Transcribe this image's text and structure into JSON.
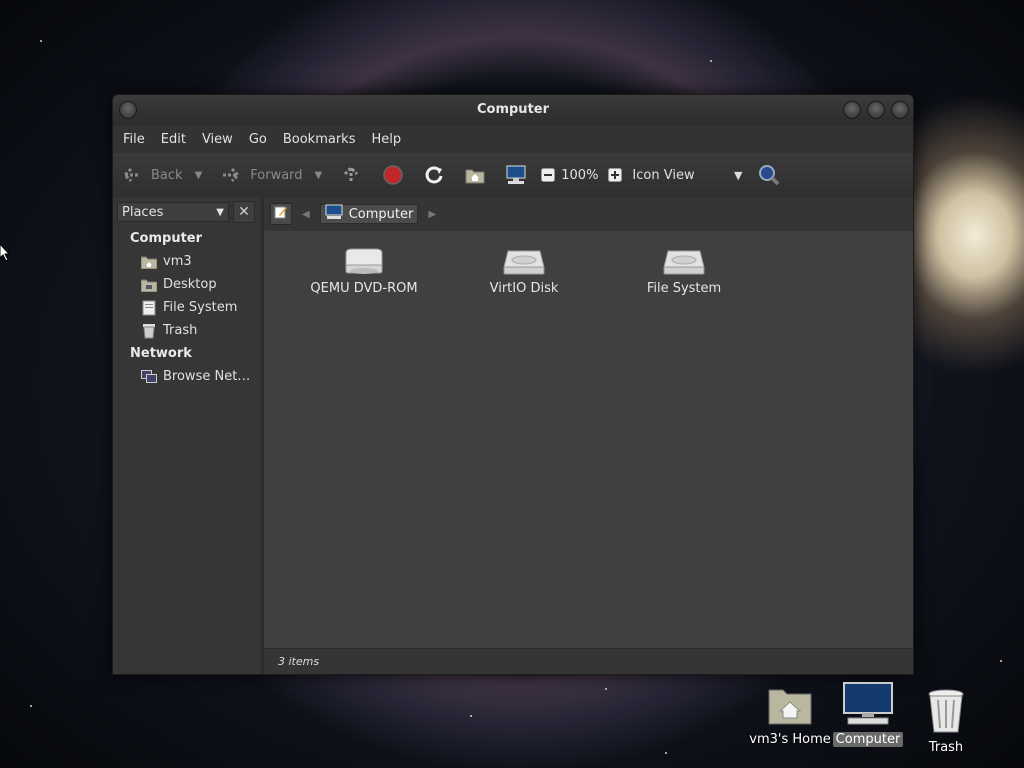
{
  "window": {
    "title": "Computer",
    "menu": [
      "File",
      "Edit",
      "View",
      "Go",
      "Bookmarks",
      "Help"
    ],
    "toolbar": {
      "back": "Back",
      "forward": "Forward",
      "zoom": "100%",
      "view_mode": "Icon View"
    },
    "sidebar": {
      "selector": "Places",
      "sections": [
        {
          "title": "Computer",
          "items": [
            "vm3",
            "Desktop",
            "File System",
            "Trash"
          ]
        },
        {
          "title": "Network",
          "items": [
            "Browse Net…"
          ]
        }
      ]
    },
    "pathbar": {
      "current": "Computer"
    },
    "items": [
      {
        "label": "QEMU DVD-ROM",
        "icon": "optical-drive-icon"
      },
      {
        "label": "VirtIO Disk",
        "icon": "hard-disk-icon"
      },
      {
        "label": "File System",
        "icon": "hard-disk-icon"
      }
    ],
    "status": "3 items"
  },
  "desktop": {
    "icons": [
      {
        "label": "vm3's Home",
        "icon": "home-folder-icon"
      },
      {
        "label": "Computer",
        "icon": "computer-icon",
        "selected": true
      },
      {
        "label": "Trash",
        "icon": "trash-icon"
      }
    ]
  },
  "colors": {
    "window_bg": "#3a3a3a",
    "content_bg": "#404040",
    "stop_button": "#c0262a",
    "selection": "#6a6a6a"
  }
}
